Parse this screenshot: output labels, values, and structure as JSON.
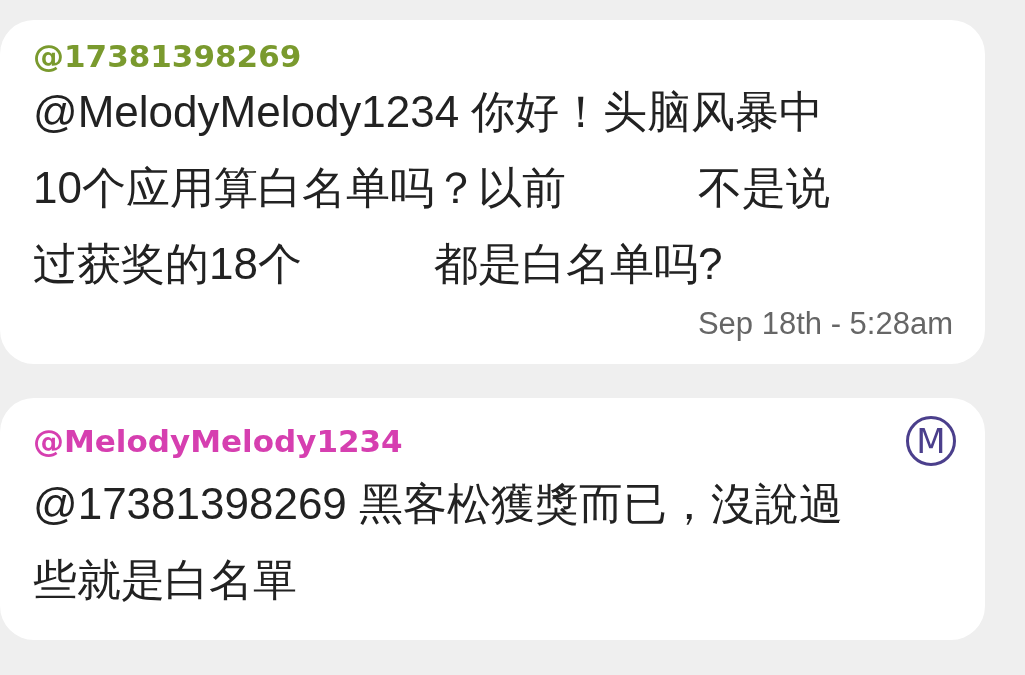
{
  "messages": [
    {
      "author": "@17381398269",
      "color": "#7a9a2e",
      "text": "@MelodyMelody1234 你好！头脑风暴中10个应用算白名单吗？以前　　　不是说过获奖的18个　　　都是白名单吗?",
      "time": "Sep 18th - 5:28am"
    },
    {
      "author": "@MelodyMelody1234",
      "color": "#d63fb0",
      "badge": "M",
      "text": "@17381398269 黑客松獲獎而已，沒說過些就是白名單"
    }
  ]
}
